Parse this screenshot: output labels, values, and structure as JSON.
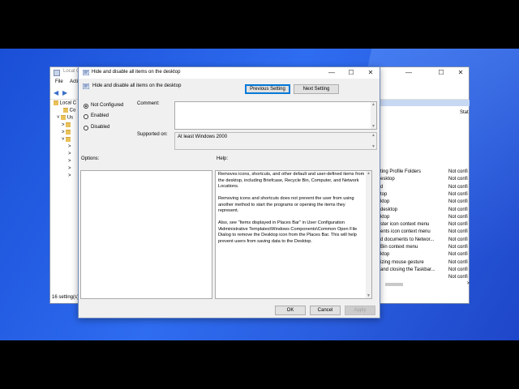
{
  "background_window": {
    "title": "Local Group Policy Editor",
    "title_visible": "Local G",
    "menu": [
      "File",
      "Acti"
    ],
    "tree_items": [
      "Local C",
      "Co",
      "Us"
    ],
    "status_bar": "16 setting(s)",
    "column_state_header": "Stat",
    "rows": [
      {
        "name": "ting Profile Folders",
        "state": "Not confi"
      },
      {
        "name": "esktop",
        "state": "Not confi"
      },
      {
        "name": "d",
        "state": "Not confi"
      },
      {
        "name": "top",
        "state": "Not confi"
      },
      {
        "name": "ktop",
        "state": "Not confi"
      },
      {
        "name": "desktop",
        "state": "Not confi"
      },
      {
        "name": "ktop",
        "state": "Not confi"
      },
      {
        "name": "ster icon context menu",
        "state": "Not confi"
      },
      {
        "name": "ents icon context menu",
        "state": "Not confi"
      },
      {
        "name": "d documents to Networ...",
        "state": "Not confi"
      },
      {
        "name": "Bin context menu",
        "state": "Not confi"
      },
      {
        "name": "ktop",
        "state": "Not confi"
      },
      {
        "name": "izing mouse gesture",
        "state": "Not confi"
      },
      {
        "name": "and closing the Taskbar...",
        "state": "Not confi"
      },
      {
        "name": "",
        "state": "Not confi"
      }
    ]
  },
  "dialog": {
    "title": "Hide and disable all items on the desktop",
    "header_setting_name": "Hide and disable all items on the desktop",
    "prev_button": "Previous Setting",
    "next_button": "Next Setting",
    "radios": [
      {
        "label": "Not Configured",
        "selected": true
      },
      {
        "label": "Enabled",
        "selected": false
      },
      {
        "label": "Disabled",
        "selected": false
      }
    ],
    "comment_label": "Comment:",
    "comment_value": "",
    "supported_label": "Supported on:",
    "supported_value": "At least Windows 2000",
    "options_label": "Options:",
    "help_label": "Help:",
    "help_paragraphs": [
      "Removes icons, shortcuts, and other default and user-defined items from the desktop, including Briefcase, Recycle Bin, Computer, and Network Locations.",
      "Removing icons and shortcuts does not prevent the user from using another method to start the programs or opening the items they represent.",
      "Also, see \"Items displayed in Places Bar\" in User Configuration \\Administrative Templates\\Windows Components\\Common Open File Dialog to remove the Desktop icon from the Places Bar. This will help prevent users from saving data to the Desktop."
    ],
    "ok_button": "OK",
    "cancel_button": "Cancel",
    "apply_button": "Apply"
  }
}
